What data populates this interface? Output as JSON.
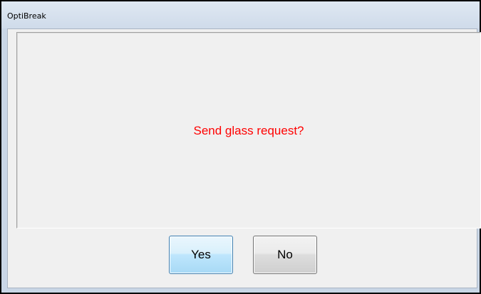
{
  "window": {
    "title": "OptiBreak"
  },
  "dialog": {
    "message": "Send glass request?",
    "message_color": "#ff0000",
    "yes_label": "Yes",
    "no_label": "No"
  }
}
